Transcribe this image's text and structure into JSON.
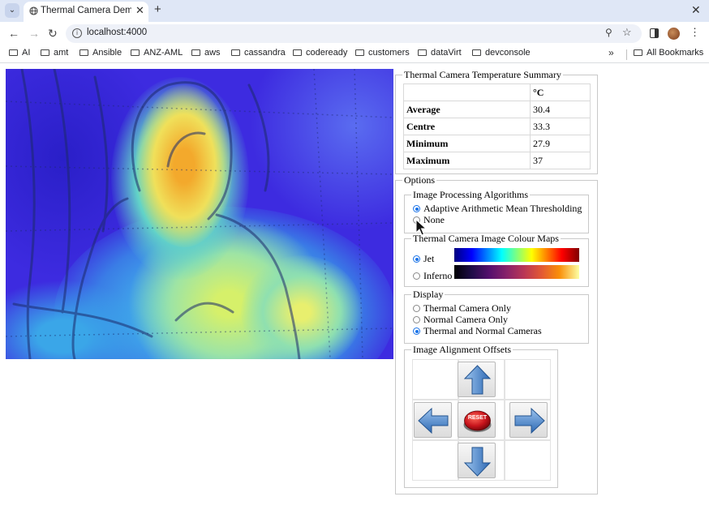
{
  "browser": {
    "tab_title": "Thermal Camera Demonstrator",
    "url": "localhost:4000",
    "bookmarks": [
      "AI",
      "amt",
      "Ansible",
      "ANZ-AML",
      "aws",
      "cassandra",
      "codeready",
      "customers",
      "dataVirt",
      "devconsole"
    ],
    "bookmarks_more": "»",
    "all_bookmarks": "All Bookmarks"
  },
  "summary": {
    "legend": "Thermal Camera Temperature Summary",
    "unit_header": "°C",
    "rows": [
      {
        "label": "Average",
        "value": "30.4"
      },
      {
        "label": "Centre",
        "value": "33.3"
      },
      {
        "label": "Minimum",
        "value": "27.9"
      },
      {
        "label": "Maximum",
        "value": "37"
      }
    ]
  },
  "options": {
    "legend": "Options",
    "algorithms": {
      "legend": "Image Processing Algorithms",
      "items": [
        "Adaptive Arithmetic Mean Thresholding",
        "None"
      ],
      "selected": "Adaptive Arithmetic Mean Thresholding"
    },
    "colour_maps": {
      "legend": "Thermal Camera Image Colour Maps",
      "items": [
        "Jet",
        "Inferno"
      ],
      "selected": "Jet"
    },
    "display": {
      "legend": "Display",
      "items": [
        "Thermal Camera Only",
        "Normal Camera Only",
        "Thermal and Normal Cameras"
      ],
      "selected": "Thermal and Normal Cameras"
    },
    "alignment": {
      "legend": "Image Alignment Offsets",
      "reset_label": "RESET"
    }
  },
  "icons": {
    "up": "arrow-up-icon",
    "down": "arrow-down-icon",
    "left": "arrow-left-icon",
    "right": "arrow-right-icon",
    "reset": "reset-icon"
  },
  "colors": {
    "radio_accent": "#1a73e8",
    "arrow_blue": "#3f7fc8",
    "reset_red": "#c8141c"
  }
}
